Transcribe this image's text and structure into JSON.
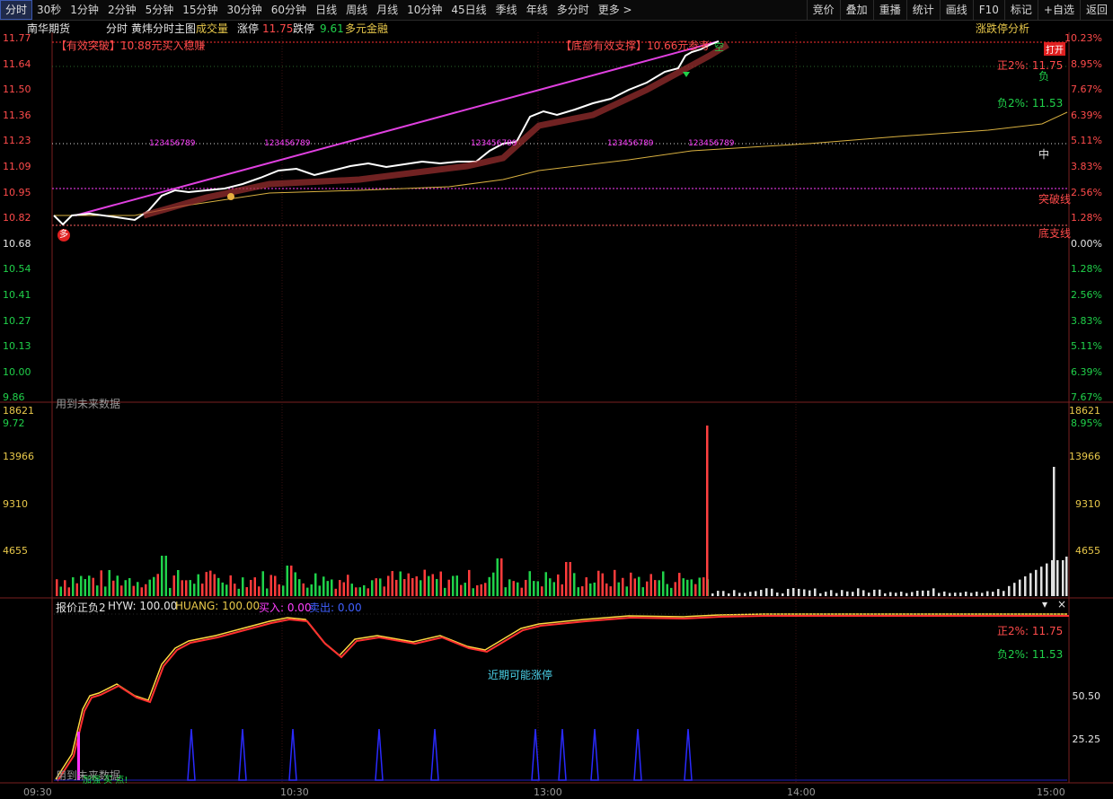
{
  "toolbar": {
    "periods": [
      "分时",
      "30秒",
      "1分钟",
      "2分钟",
      "5分钟",
      "15分钟",
      "30分钟",
      "60分钟",
      "日线",
      "周线",
      "月线",
      "10分钟",
      "45日线",
      "季线",
      "年线",
      "多分时",
      "更多 >"
    ],
    "tools": [
      "竞价",
      "叠加",
      "重播",
      "统计",
      "画线",
      "F10",
      "标记",
      "+自选",
      "返回"
    ]
  },
  "info": {
    "name": "南华期货",
    "mode": "分时",
    "template": "黄炜分时主图",
    "vol_label": "成交量",
    "zt_label": "涨停",
    "zt_val": "11.75",
    "dt_label": "跌停",
    "dt_val": "9.61",
    "tag": "多元金融",
    "right_btn": "涨跌停分析"
  },
  "main": {
    "price_ticks": [
      "11.77",
      "11.64",
      "11.50",
      "11.36",
      "11.23",
      "11.09",
      "10.95",
      "10.82",
      "10.68",
      "10.54",
      "10.41",
      "10.27",
      "10.13",
      "10.00",
      "9.86",
      "9.72"
    ],
    "pct_ticks": [
      "10.23%",
      "8.95%",
      "7.67%",
      "6.39%",
      "5.11%",
      "3.83%",
      "2.56%",
      "1.28%",
      "0.00%",
      "1.28%",
      "2.56%",
      "3.83%",
      "5.11%",
      "6.39%",
      "7.67%",
      "8.95%"
    ],
    "annot_left": "【有效突破】10.88元买入稳赚",
    "annot_mid": "【底部有效支撑】10.66元参考",
    "zheng2": "正2%: 11.75",
    "fu2": "负2%: 11.53",
    "fu_char": "负",
    "zhong_char": "中",
    "tupo": "突破线",
    "zhicheng": "底支线",
    "kong": "空",
    "duo": "多",
    "future": "用到未来数据",
    "seq_labels": [
      "123456789",
      "123456789",
      "123456789",
      "123456789",
      "123456789"
    ],
    "dashed_on": "打开"
  },
  "volume": {
    "ticks": [
      "18621",
      "13966",
      "9310",
      "4655"
    ]
  },
  "indicator": {
    "title": "报价正负2",
    "hyw": "HYW: 100.00",
    "huang": "HUANG: 100.00",
    "buy": "买入: 0.00",
    "sell": "卖出: 0.00",
    "zheng2": "正2%: 11.75",
    "fu2": "负2%: 11.53",
    "note": "近期可能涨停",
    "ticks": [
      "50.50",
      "25.25"
    ],
    "future": "用到未来数据",
    "bottom_text": "加强 买 点!"
  },
  "time_axis": [
    "09:30",
    "10:30",
    "13:00",
    "14:00",
    "15:00"
  ],
  "colors": {
    "up": "#ff3b3b",
    "down": "#1fd24a",
    "price": "#ffffff",
    "avg": "#d8b040",
    "trend": "#e040e0"
  }
}
